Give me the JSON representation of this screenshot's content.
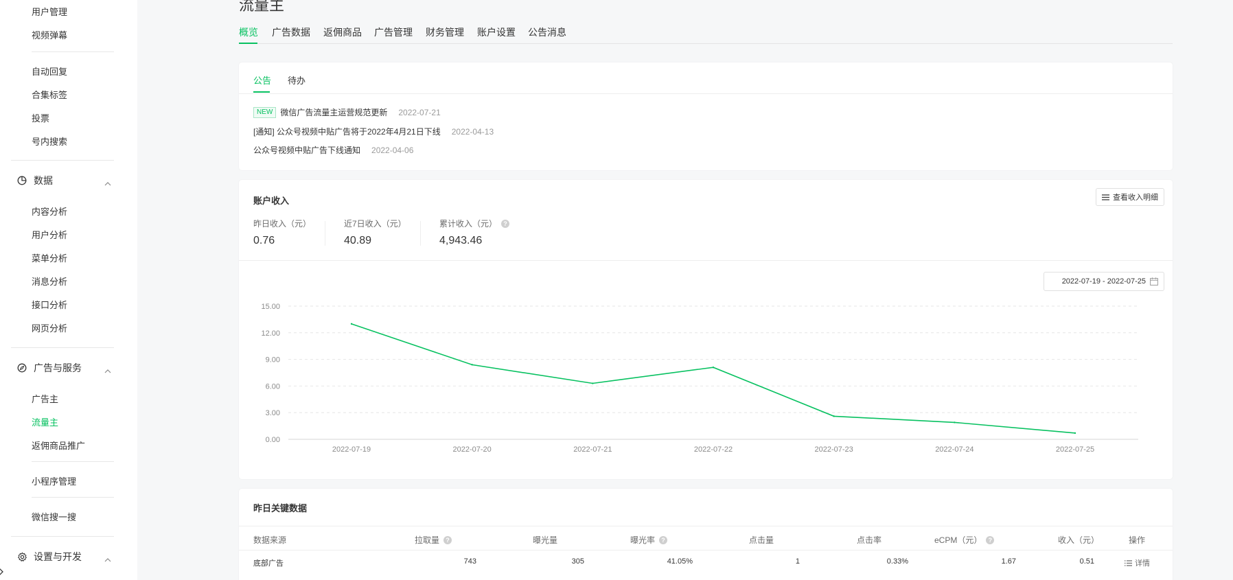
{
  "sidebar": {
    "items_top": [
      "用户管理",
      "视频弹幕"
    ],
    "items_mid": [
      "自动回复",
      "合集标签",
      "投票",
      "号内搜索"
    ],
    "group_data": "数据",
    "items_data": [
      "内容分析",
      "用户分析",
      "菜单分析",
      "消息分析",
      "接口分析",
      "网页分析"
    ],
    "group_ads": "广告与服务",
    "items_ads": [
      "广告主",
      "流量主",
      "返佣商品推广"
    ],
    "item_miniprogram": "小程序管理",
    "item_search": "微信搜一搜",
    "group_settings": "设置与开发"
  },
  "page_title": "流量主",
  "tabs": [
    "概览",
    "广告数据",
    "返佣商品",
    "广告管理",
    "财务管理",
    "账户设置",
    "公告消息"
  ],
  "notice": {
    "tabs": [
      "公告",
      "待办"
    ],
    "badge": "NEW",
    "items": [
      {
        "title": "微信广告流量主运营规范更新",
        "date": "2022-07-21"
      },
      {
        "title": "[通知] 公众号视频中贴广告将于2022年4月21日下线",
        "date": "2022-04-13"
      },
      {
        "title": "公众号视频中贴广告下线通知",
        "date": "2022-04-06"
      }
    ]
  },
  "income": {
    "title": "账户收入",
    "detail_button": "查看收入明细",
    "stats": [
      {
        "label": "昨日收入（元）",
        "value": "0.76"
      },
      {
        "label": "近7日收入（元）",
        "value": "40.89"
      },
      {
        "label": "累计收入（元）",
        "value": "4,943.46"
      }
    ],
    "date_range": "2022-07-19 - 2022-07-25"
  },
  "chart_data": {
    "type": "line",
    "x": [
      "2022-07-19",
      "2022-07-20",
      "2022-07-21",
      "2022-07-22",
      "2022-07-23",
      "2022-07-24",
      "2022-07-25"
    ],
    "series": [
      {
        "values": [
          13.0,
          8.4,
          6.3,
          8.1,
          2.6,
          1.9,
          0.7
        ]
      }
    ],
    "y_ticks": [
      "0.00",
      "3.00",
      "6.00",
      "9.00",
      "12.00",
      "15.00"
    ],
    "ylim": [
      0,
      15
    ],
    "grid": true,
    "color": "#07c160"
  },
  "key_data": {
    "title": "昨日关键数据",
    "headers": [
      "数据来源",
      "拉取量",
      "曝光量",
      "曝光率",
      "点击量",
      "点击率",
      "eCPM（元）",
      "收入（元）",
      "操作"
    ],
    "rows": [
      {
        "source": "底部广告",
        "pull": "743",
        "exposure": "305",
        "exposure_rate": "41.05%",
        "clicks": "1",
        "ctr": "0.33%",
        "ecpm": "1.67",
        "income": "0.51",
        "action": "详情"
      }
    ]
  },
  "colors": {
    "accent": "#07c160",
    "text": "#353535",
    "muted": "#9a9a9a"
  }
}
